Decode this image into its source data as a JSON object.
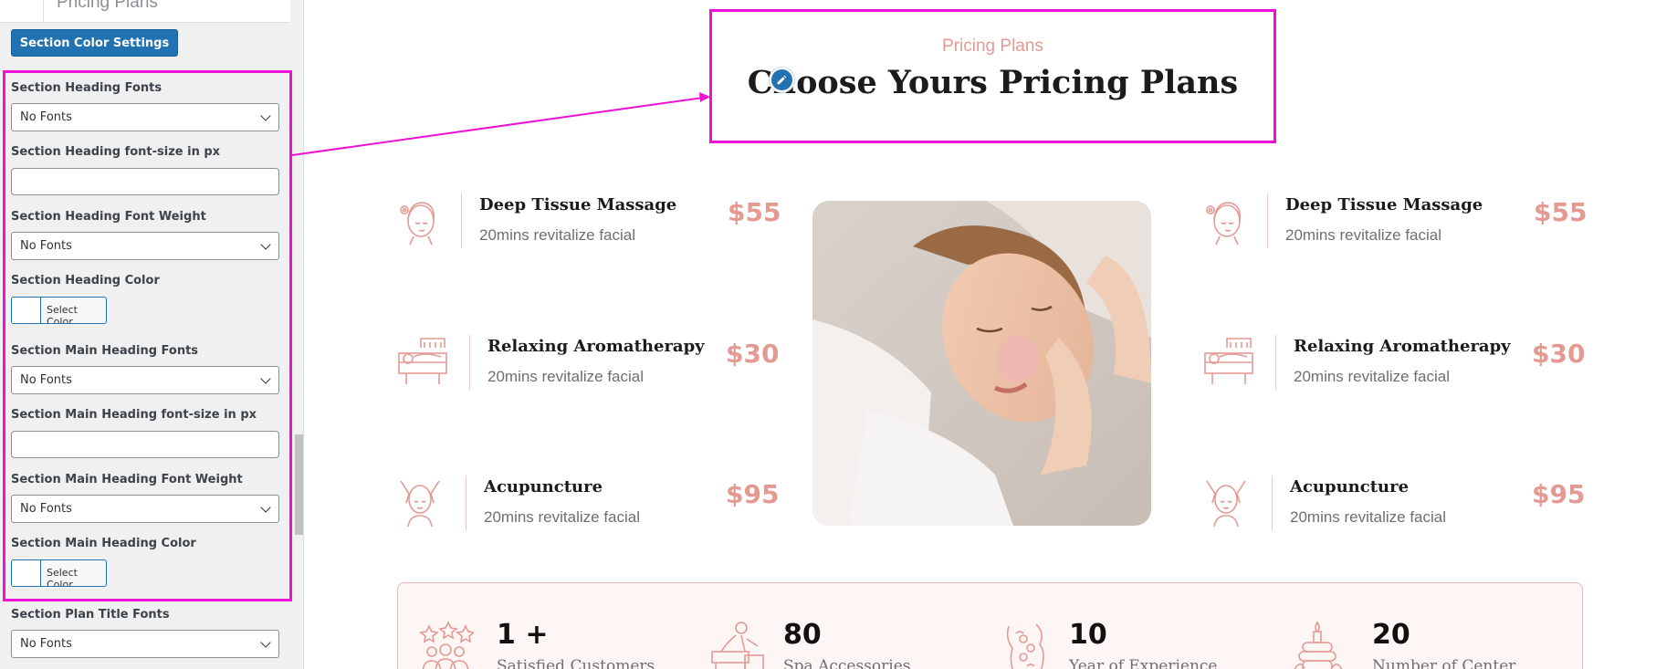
{
  "sidebar": {
    "top_item_label": "Pricing Plans",
    "color_settings_button": "Section Color Settings",
    "fields": {
      "heading_fonts_label": "Section Heading Fonts",
      "heading_fonts_value": "No Fonts",
      "heading_size_label": "Section Heading font-size in px",
      "heading_size_value": "",
      "heading_weight_label": "Section Heading Font Weight",
      "heading_weight_value": "No Fonts",
      "heading_color_label": "Section Heading Color",
      "heading_color_button": "Select Color",
      "main_fonts_label": "Section Main Heading Fonts",
      "main_fonts_value": "No Fonts",
      "main_size_label": "Section Main Heading font-size in px",
      "main_size_value": "",
      "main_weight_label": "Section Main Heading Font Weight",
      "main_weight_value": "No Fonts",
      "main_color_label": "Section Main Heading Color",
      "main_color_button": "Select Color",
      "plan_title_fonts_label": "Section Plan Title Fonts",
      "plan_title_fonts_value": "No Fonts"
    }
  },
  "preview": {
    "subheading": "Pricing Plans",
    "heading": "Choose Yours Pricing Plans",
    "left_services": [
      {
        "title": "Deep Tissue Massage",
        "desc": "20mins revitalize facial",
        "price": "$55",
        "icon": "facial-woman-icon"
      },
      {
        "title": "Relaxing Aromatherapy",
        "desc": "20mins revitalize facial",
        "price": "$30",
        "icon": "spa-bed-icon"
      },
      {
        "title": "Acupuncture",
        "desc": "20mins revitalize facial",
        "price": "$95",
        "icon": "face-massage-icon"
      }
    ],
    "right_services": [
      {
        "title": "Deep Tissue Massage",
        "desc": "20mins revitalize facial",
        "price": "$55",
        "icon": "facial-woman-icon"
      },
      {
        "title": "Relaxing Aromatherapy",
        "desc": "20mins revitalize facial",
        "price": "$30",
        "icon": "spa-bed-icon"
      },
      {
        "title": "Acupuncture",
        "desc": "20mins revitalize facial",
        "price": "$95",
        "icon": "face-massage-icon"
      }
    ],
    "stats": [
      {
        "number": "1 +",
        "label": "Satisfied Customers"
      },
      {
        "number": "80",
        "label": "Spa Accessories"
      },
      {
        "number": "10",
        "label": "Year of Experience"
      },
      {
        "number": "20",
        "label": "Number of Center"
      }
    ]
  },
  "colors": {
    "accent": "#e49a93",
    "highlight": "#ee10d4",
    "wp_blue": "#2271b1"
  }
}
